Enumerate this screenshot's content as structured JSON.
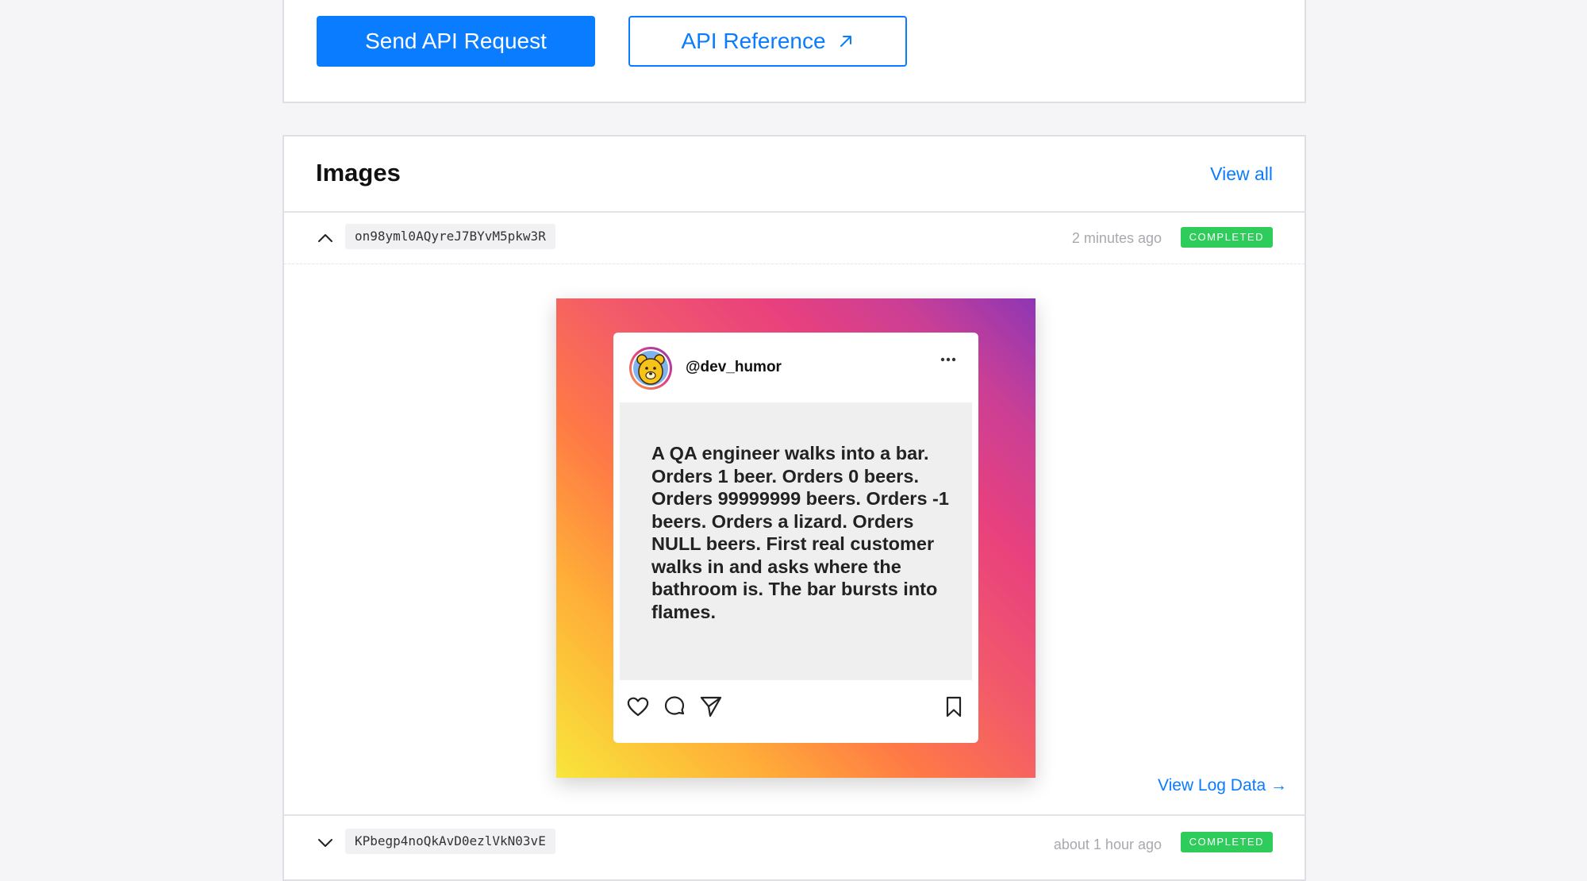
{
  "toolbar": {
    "send_label": "Send API Request",
    "reference_label": "API Reference",
    "accent_color": "#0a7cff"
  },
  "images": {
    "title": "Images",
    "view_all_label": "View all",
    "items": [
      {
        "id": "on98yml0AQyreJ7BYvM5pkw3R",
        "time": "2 minutes ago",
        "status": "COMPLETED",
        "expanded": true,
        "post": {
          "username": "@dev_humor",
          "text": "A QA engineer walks into a bar. Orders 1 beer. Orders 0 beers. Orders 99999999 beers. Orders -1 beers. Orders a lizard. Orders NULL beers. First real customer walks in and asks where the bathroom is. The bar bursts into flames.",
          "icons": [
            "heart-icon",
            "comment-icon",
            "send-icon",
            "bookmark-icon",
            "more-icon"
          ]
        },
        "view_log_label": "View Log Data →"
      },
      {
        "id": "KPbegp4noQkAvD0ezlVkN03vE",
        "time": "about 1 hour ago",
        "status": "COMPLETED",
        "expanded": false
      }
    ]
  },
  "status_color": "#2ecc5a"
}
